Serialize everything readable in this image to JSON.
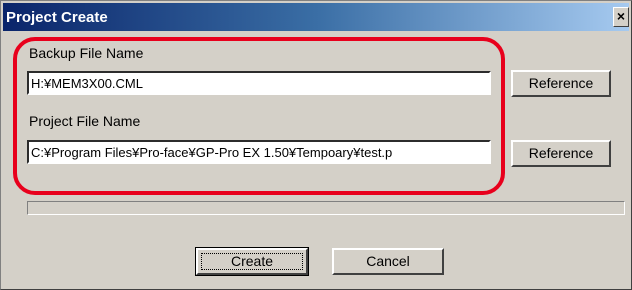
{
  "window": {
    "title": "Project Create",
    "close_glyph": "×"
  },
  "backup": {
    "label": "Backup File Name",
    "value": "H:¥MEM3X00.CML",
    "button_label": "Reference"
  },
  "project": {
    "label": "Project File Name",
    "value": "C:¥Program Files¥Pro-face¥GP-Pro EX 1.50¥Tempoary¥test.p",
    "button_label": "Reference"
  },
  "progress": {
    "fraction": 0
  },
  "actions": {
    "create_label": "Create",
    "cancel_label": "Cancel"
  },
  "colors": {
    "highlight": "#e8001c",
    "title_bar": "#0a246a"
  }
}
